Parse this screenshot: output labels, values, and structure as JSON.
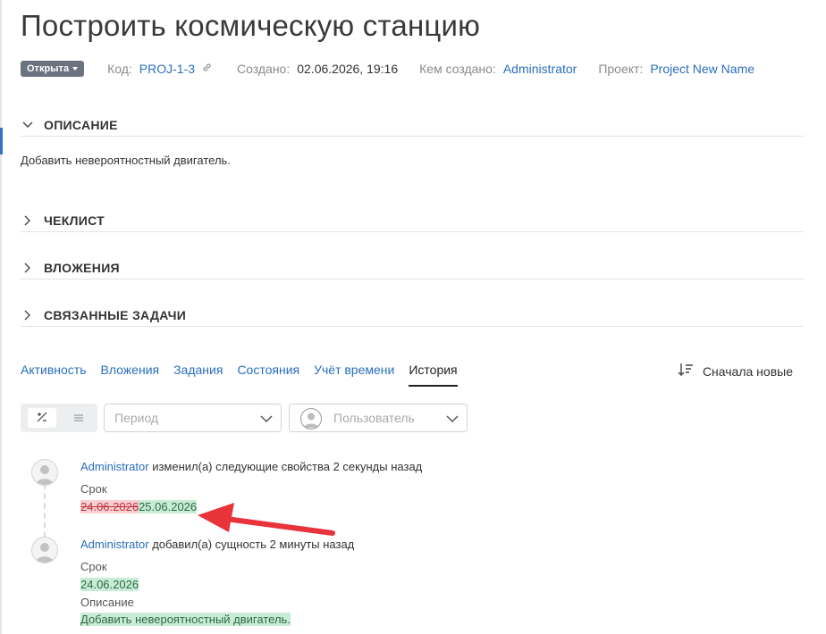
{
  "page": {
    "title": "Построить космическую станцию"
  },
  "meta": {
    "status": "Открыта",
    "code_label": "Код:",
    "code_value": "PROJ-1-3",
    "created_label": "Создано:",
    "created_value": "02.06.2026, 19:16",
    "author_label": "Кем создано:",
    "author_value": "Administrator",
    "project_label": "Проект:",
    "project_value": "Project New Name"
  },
  "sections": {
    "description": {
      "title": "ОПИСАНИЕ",
      "text": "Добавить невероятностный двигатель.",
      "expanded": true
    },
    "checklist": {
      "title": "ЧЕКЛИСТ"
    },
    "attachments": {
      "title": "ВЛОЖЕНИЯ"
    },
    "linked": {
      "title": "СВЯЗАННЫЕ ЗАДАЧИ"
    }
  },
  "tabs": [
    {
      "label": "Активность"
    },
    {
      "label": "Вложения"
    },
    {
      "label": "Задания"
    },
    {
      "label": "Состояния"
    },
    {
      "label": "Учёт времени"
    },
    {
      "label": "История",
      "active": true
    }
  ],
  "sort": {
    "label": "Сначала новые"
  },
  "filters": {
    "view_toggle": [
      "diff-icon",
      "list-icon"
    ],
    "period_placeholder": "Период",
    "user_placeholder": "Пользователь"
  },
  "history": [
    {
      "user": "Administrator",
      "action": "изменил(а) следующие свойства 2 секунды назад",
      "changes": [
        {
          "field": "Срок",
          "old": "24.06.2026",
          "new": "25.06.2026"
        }
      ]
    },
    {
      "user": "Administrator",
      "action": "добавил(а) сущность 2 минуты назад",
      "changes": [
        {
          "field": "Срок",
          "new": "24.06.2026"
        },
        {
          "field": "Описание",
          "new": "Добавить невероятностный двигатель."
        }
      ]
    }
  ],
  "colors": {
    "link": "#2a6ebb",
    "badge": "#6b7280",
    "diff_removed_bg": "#f8d0d2",
    "diff_added_bg": "#c8ecd6",
    "arrow": "#e8333b"
  }
}
